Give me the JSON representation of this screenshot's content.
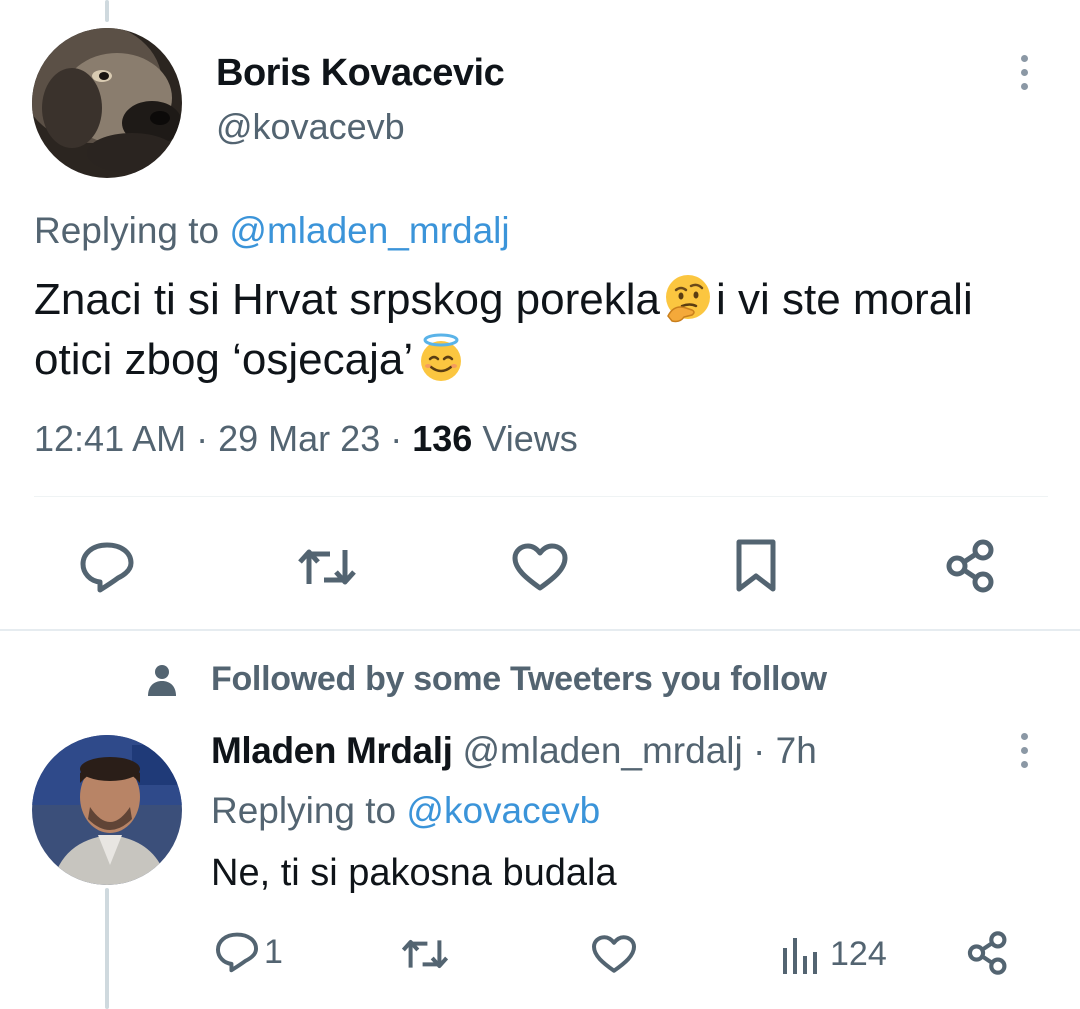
{
  "main_tweet": {
    "author_name": "Boris Kovacevic",
    "author_handle": "@kovacevb",
    "replying_prefix": "Replying to",
    "replying_to": "@mladen_mrdalj",
    "text_part1": "Znaci ti si Hrvat srpskog porekla",
    "text_part2": "i vi ste morali otici zbog ‘osjecaja’",
    "emoji1": "thinking-face",
    "emoji2": "smiling-face-with-halo",
    "time": "12:41 AM",
    "date": "29 Mar 23",
    "views_count": "136",
    "views_label": "Views",
    "actions": [
      "reply",
      "retweet",
      "like",
      "bookmark",
      "share"
    ]
  },
  "social_context": {
    "text": "Followed by some Tweeters you follow",
    "icon": "person-icon"
  },
  "reply_tweet": {
    "author_name": "Mladen Mrdalj",
    "author_handle": "@mladen_mrdalj",
    "separator": "·",
    "time_ago": "7h",
    "replying_prefix": "Replying to",
    "replying_to": "@kovacevb",
    "text": "Ne, ti si pakosna budala",
    "reply_count": "1",
    "views_count": "124"
  },
  "colors": {
    "text": "#0f1419",
    "secondary": "#536471",
    "link": "#1d9bf0",
    "divider": "#eff3f4"
  }
}
